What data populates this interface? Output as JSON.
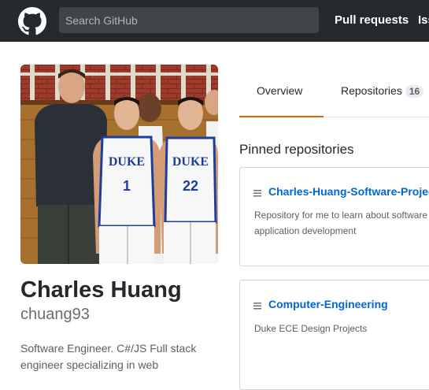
{
  "header": {
    "search": {
      "placeholder": "Search GitHub"
    },
    "nav": {
      "pull_requests": "Pull requests",
      "issues": "Issues"
    }
  },
  "profile": {
    "full_name": "Charles Huang",
    "username": "chuang93",
    "bio": "Software Engineer. C#/JS Full stack engineer specializing in web"
  },
  "tabs": [
    {
      "label": "Overview",
      "selected": true
    },
    {
      "label": "Repositories",
      "count": "16"
    }
  ],
  "pinned": {
    "title": "Pinned repositories",
    "repos": [
      {
        "name": "Charles-Huang-Software-Projects",
        "description": "Repository for me to learn about software tools and application development"
      },
      {
        "name": "Computer-Engineering",
        "description": "Duke ECE Design Projects"
      }
    ]
  },
  "colors": {
    "header_bg": "#24292e",
    "link": "#0366d6",
    "tab_accent": "#e36209"
  },
  "icons": [
    "github-logo-icon",
    "repo-icon"
  ]
}
